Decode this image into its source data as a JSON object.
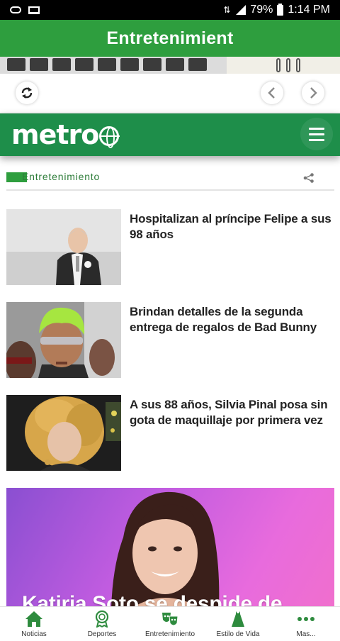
{
  "status_bar": {
    "battery": "79%",
    "time": "1:14 PM"
  },
  "app_bar": {
    "title": "Entretenimient"
  },
  "metro": {
    "logo_text": "metro"
  },
  "section": {
    "label": "Entretenimiento"
  },
  "articles": [
    {
      "headline": "Hospitalizan al príncipe Felipe a sus 98 años"
    },
    {
      "headline": "Brindan detalles de la segunda entrega de regalos de Bad Bunny"
    },
    {
      "headline": "A sus 88 años, Silvia Pinal posa sin gota de maquillaje por primera vez"
    }
  ],
  "featured": {
    "title": "Katiria Soto se despide de"
  },
  "bottom_nav": [
    {
      "label": "Noticias",
      "icon": "home-icon"
    },
    {
      "label": "Deportes",
      "icon": "medal-icon"
    },
    {
      "label": "Entretenimiento",
      "icon": "theater-masks-icon"
    },
    {
      "label": "Estilo de Vida",
      "icon": "dress-icon"
    },
    {
      "label": "Mas...",
      "icon": "more-dots-icon"
    }
  ],
  "colors": {
    "app_green": "#2e9e3e",
    "metro_green": "#1e8e4a",
    "nav_green": "#2e8b3e"
  }
}
